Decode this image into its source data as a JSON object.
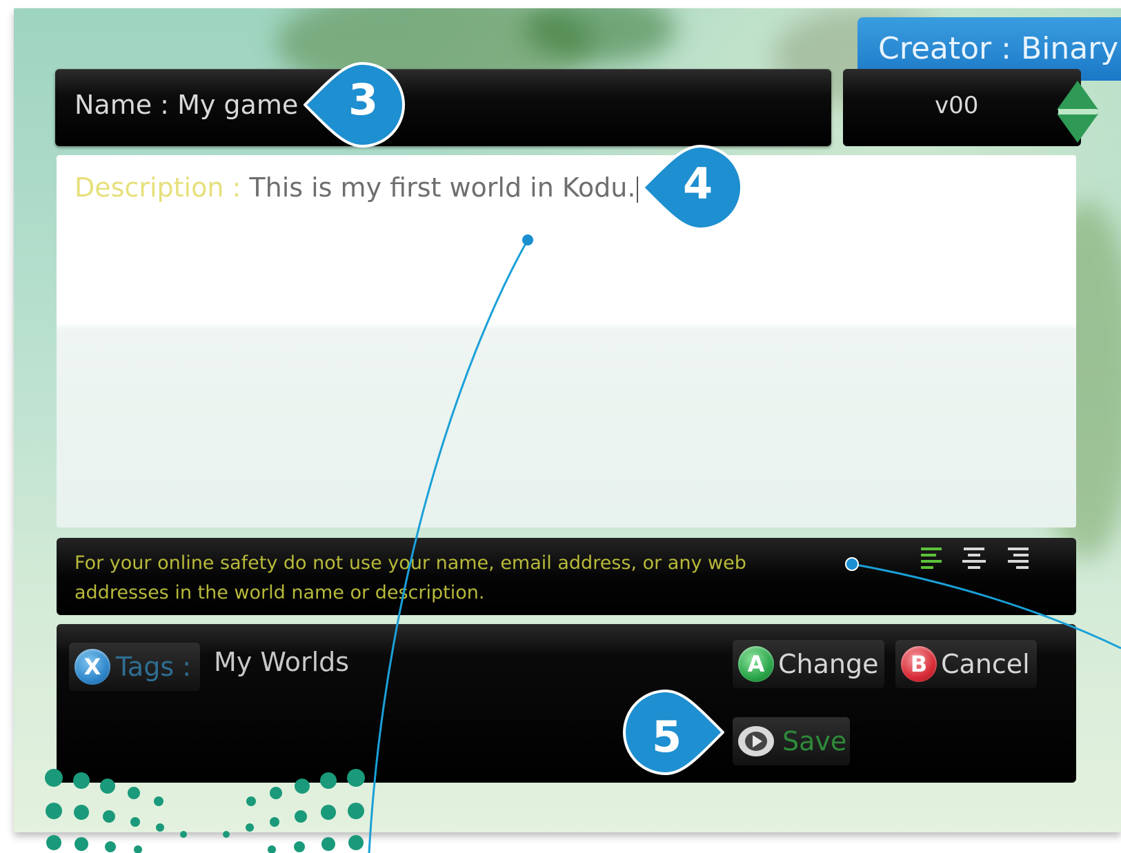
{
  "header": {
    "creator": "Creator : Binary",
    "name_field": "Name : My game",
    "version": "v00"
  },
  "description": {
    "label": "Description :",
    "value": " This is my first world in Kodu."
  },
  "safety_notice": "For your online safety do not use your name, email address, or any web addresses in the world name or description.",
  "footer": {
    "tags_button_letter": "X",
    "tags_label": "Tags :",
    "tags_value": "My Worlds",
    "change_button_letter": "A",
    "change_label": "Change",
    "cancel_button_letter": "B",
    "cancel_label": "Cancel",
    "save_label": "Save"
  },
  "callouts": [
    "3",
    "4",
    "5"
  ],
  "colors": {
    "callout_blue": "#1e8fd0",
    "creator_blue": "#1b78c6",
    "change_green": "#2aa54a",
    "cancel_red": "#d82a35",
    "tags_blue": "#2f86c9",
    "save_green": "#2e8a3a",
    "safety_text": "#b8ba3a",
    "description_label": "#e6e07a",
    "decor_dots": "#1a9a7a"
  },
  "icons": [
    "version-up-down-arrows-icon",
    "align-left-icon",
    "align-center-icon",
    "align-right-icon",
    "save-play-icon"
  ]
}
